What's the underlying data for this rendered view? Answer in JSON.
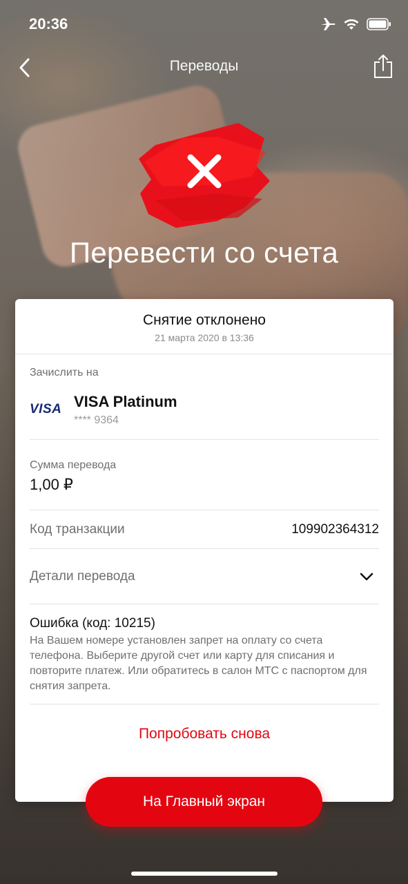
{
  "status_bar": {
    "time": "20:36"
  },
  "nav": {
    "title": "Переводы"
  },
  "page_title": "Перевести со счета",
  "card": {
    "status": "Снятие отклонено",
    "date": "21 марта 2020 в 13:36",
    "credit_to": {
      "label": "Зачислить на",
      "logo": "VISA",
      "name": "VISA Platinum",
      "number": "**** 9364"
    },
    "amount": {
      "label": "Сумма перевода",
      "value": "1,00 ₽"
    },
    "transaction": {
      "label": "Код транзакции",
      "value": "109902364312"
    },
    "details": {
      "label": "Детали перевода"
    },
    "error": {
      "title": "Ошибка (код: 10215)",
      "text": "На Вашем номере установлен запрет на оплату со счета телефона. Выберите другой счет или карту для списания и повторите платеж. Или обратитесь в салон МТС с паспортом для снятия запрета."
    },
    "retry_label": "Попробовать снова"
  },
  "home_button_label": "На Главный экран",
  "colors": {
    "accent": "#e30611",
    "visa": "#1a2b74"
  }
}
